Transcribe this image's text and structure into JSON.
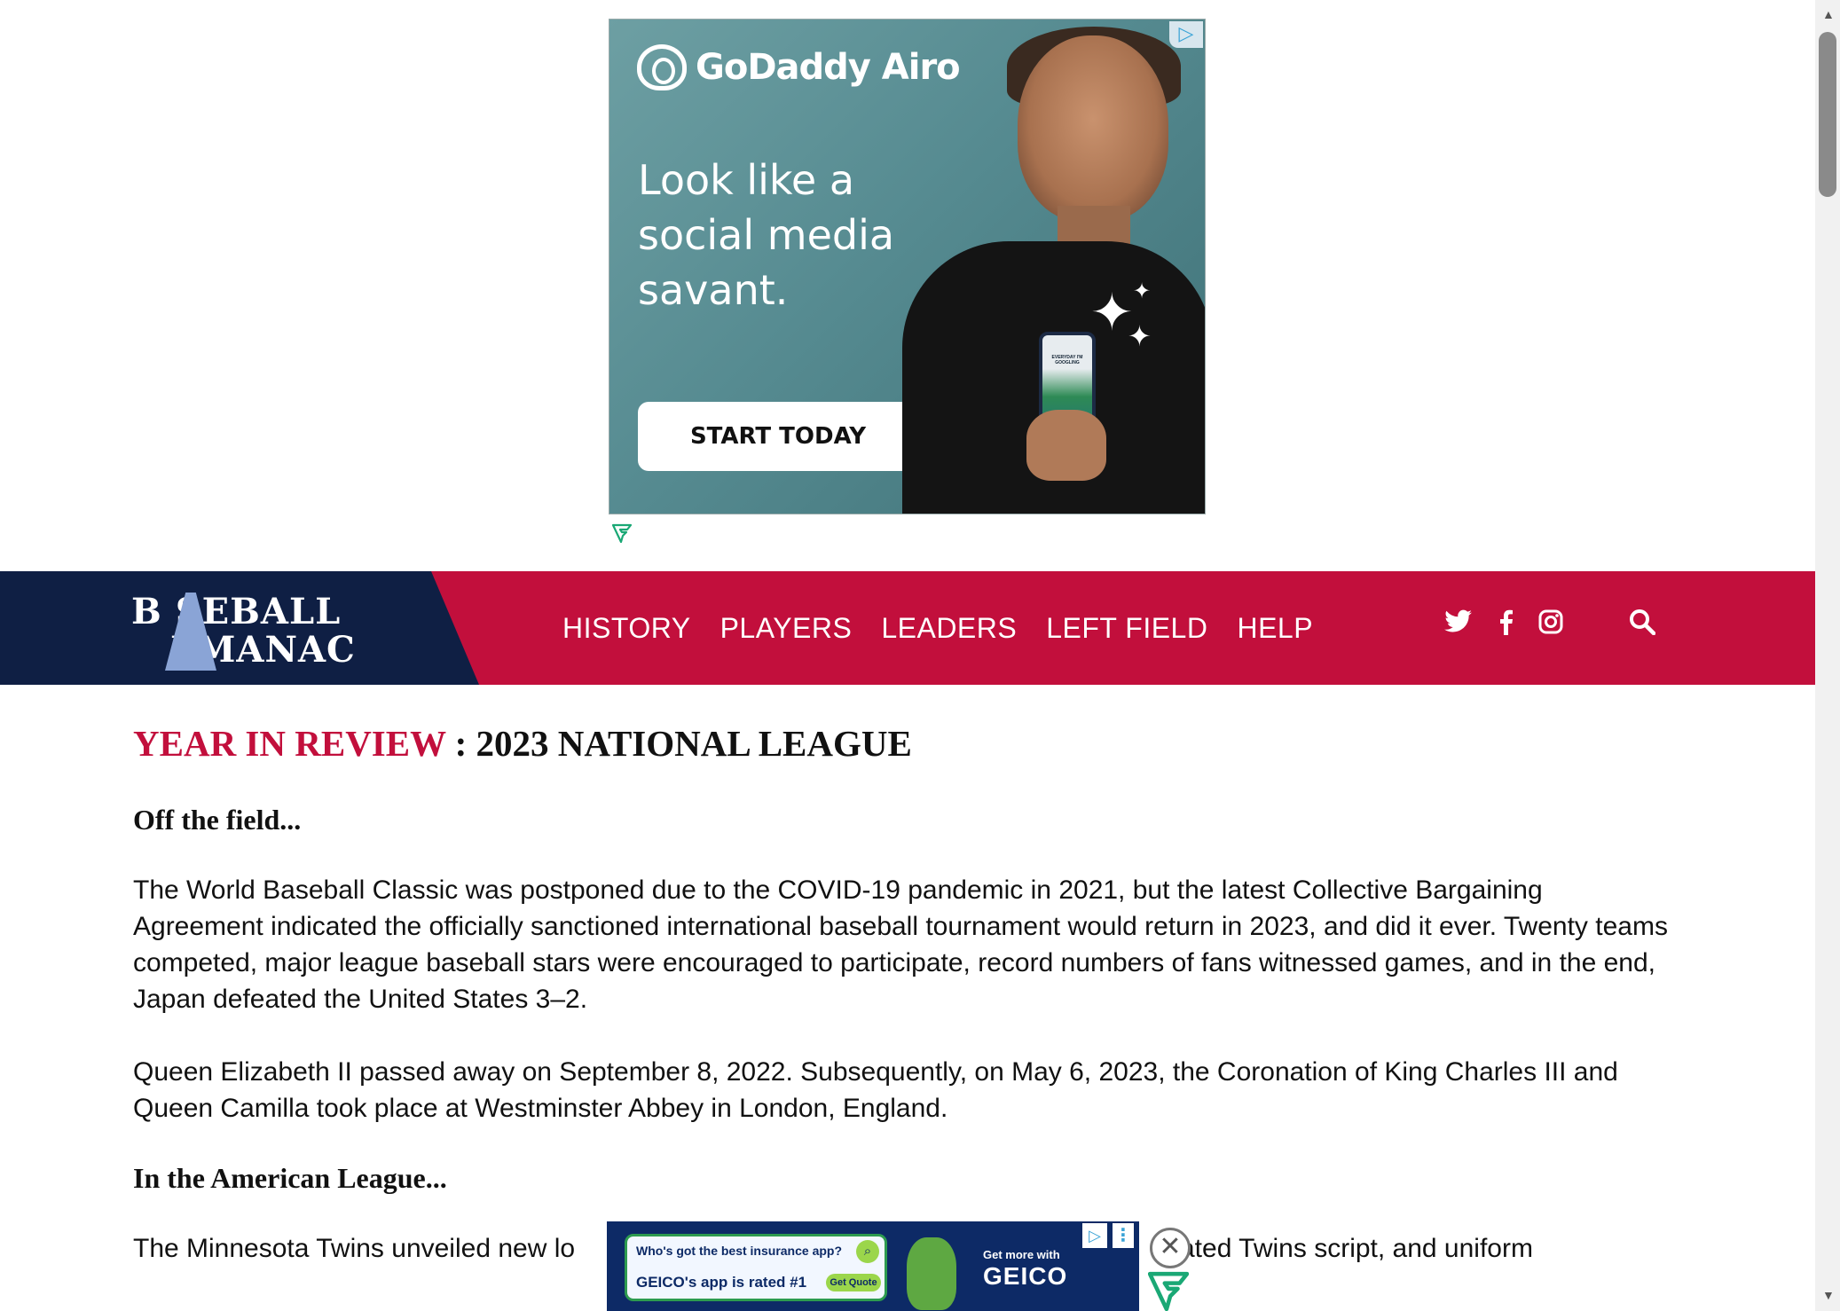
{
  "top_ad": {
    "badge_icon": "adchoices-icon",
    "brand": "GoDaddy Airo",
    "headline_lines": [
      "Look like a",
      "social media",
      "savant."
    ],
    "cta": "START TODAY",
    "phone_text": "EVERYDAY I'M GOOGLING"
  },
  "navbar": {
    "logo_line1": "B SEBALL",
    "logo_line2": "LMANAC",
    "links": [
      "HISTORY",
      "PLAYERS",
      "LEADERS",
      "LEFT FIELD",
      "HELP"
    ],
    "social_icons": [
      "twitter-icon",
      "facebook-icon",
      "instagram-icon"
    ],
    "search_icon": "search-icon",
    "colors": {
      "bar": "#c20f3c",
      "logo_panel": "#0f1f44"
    }
  },
  "article": {
    "title_accent": "YEAR IN REVIEW",
    "title_rest": " : 2023 NATIONAL LEAGUE",
    "section1": "Off the field...",
    "para1": "The World Baseball Classic was postponed due to the COVID-19 pandemic in 2021, but the latest Collective Bargaining Agreement indicated the officially sanctioned international baseball tournament would return in 2023, and did it ever. Twenty teams competed, major league baseball stars were encouraged to participate, record numbers of fans witnessed games, and in the end, Japan defeated the United States 3–2.",
    "para2": "Queen Elizabeth II passed away on September 8, 2022. Subsequently, on May 6, 2023, the Coronation of King Charles III and Queen Camilla took place at Westminster Abbey in London, England.",
    "section2": "In the American League...",
    "para3_start": "The Minnesota Twins unveiled new lo",
    "para3_end": "ated Twins script, and uniform"
  },
  "bottom_ad": {
    "question": "Who's got the best insurance app?",
    "answer": "GEICO's app is rated #1",
    "quote_button": "Get Quote",
    "get_more": "Get more with",
    "brand": "GEICO"
  }
}
